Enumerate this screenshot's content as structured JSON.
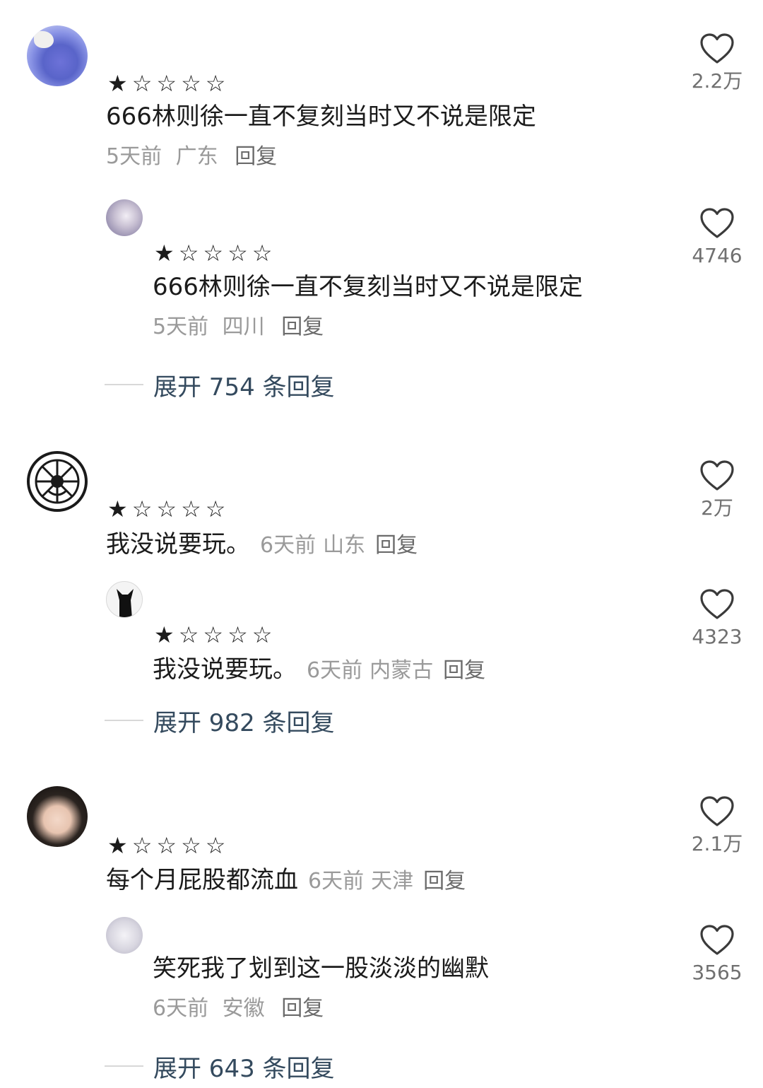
{
  "threads": [
    {
      "comment": {
        "stars": "★☆☆☆☆",
        "text": "666林则徐一直不复刻当时又不说是限定",
        "time": "5天前",
        "location": "广东",
        "reply": "回复",
        "likes": "2.2万"
      },
      "sub": {
        "stars": "★☆☆☆☆",
        "text": "666林则徐一直不复刻当时又不说是限定",
        "time": "5天前",
        "location": "四川",
        "reply": "回复",
        "likes": "4746"
      },
      "expand": "展开 754 条回复"
    },
    {
      "comment": {
        "stars": "★☆☆☆☆",
        "text": "我没说要玩。",
        "time": "6天前",
        "location": "山东",
        "reply": "回复",
        "likes": "2万"
      },
      "sub": {
        "stars": "★☆☆☆☆",
        "text": "我没说要玩。",
        "time": "6天前",
        "location": "内蒙古",
        "reply": "回复",
        "likes": "4323"
      },
      "expand": "展开 982 条回复"
    },
    {
      "comment": {
        "stars": "★☆☆☆☆",
        "text": "每个月屁股都流血",
        "time": "6天前",
        "location": "天津",
        "reply": "回复",
        "likes": "2.1万"
      },
      "sub": {
        "text": "笑死我了划到这一股淡淡的幽默",
        "time": "6天前",
        "location": "安徽",
        "reply": "回复",
        "likes": "3565"
      },
      "expand": "展开 643 条回复"
    }
  ],
  "icons": {
    "like": "heart-outline-icon"
  },
  "colors": {
    "text": "#1b1b1b",
    "meta": "#9a9a9a",
    "expand": "#344a5e"
  }
}
